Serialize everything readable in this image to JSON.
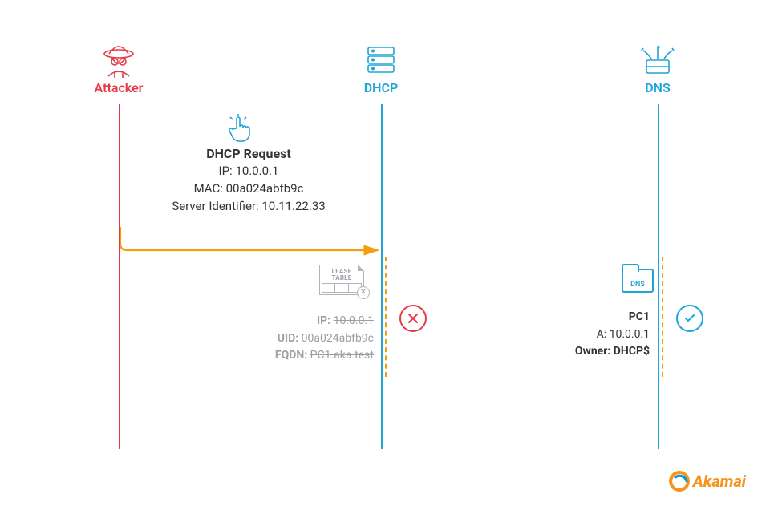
{
  "actors": {
    "attacker": {
      "label": "Attacker"
    },
    "dhcp": {
      "label": "DHCP"
    },
    "dns": {
      "label": "DNS"
    }
  },
  "request": {
    "title": "DHCP Request",
    "ip_label": "IP:",
    "ip_value": "10.0.0.1",
    "mac_label": "MAC:",
    "mac_value": "00a024abfb9c",
    "sid_label": "Server Identifier:",
    "sid_value": "10.11.22.33"
  },
  "lease": {
    "tile_caption_line1": "LEASE",
    "tile_caption_line2": "TABLE",
    "ip_label": "IP:",
    "ip_value": "10.0.0.1",
    "uid_label": "UID:",
    "uid_value": "00a024abfb9c",
    "fqdn_label": "FQDN:",
    "fqdn_value": "PC1.aka.test"
  },
  "dns_record": {
    "folder_label": "DNS",
    "title": "PC1",
    "a_label": "A:",
    "a_value": "10.0.0.1",
    "owner_label": "Owner:",
    "owner_value": "DHCP$"
  },
  "brand": {
    "name": "Akamai"
  },
  "colors": {
    "attacker": "#e63946",
    "akamai_blue": "#1fa4d8",
    "akamai_orange": "#f7941e",
    "muted": "#9aa0a6",
    "arrow": "#f59e0b"
  }
}
